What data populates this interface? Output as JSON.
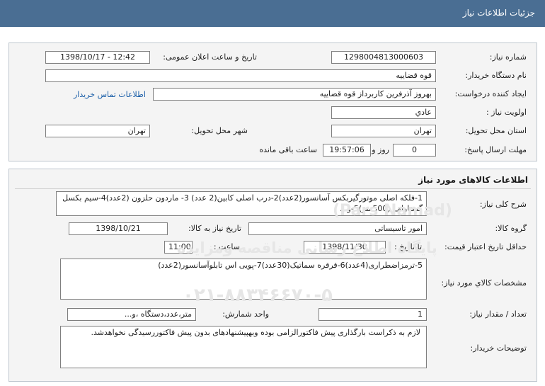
{
  "header": {
    "title": "جزئیات اطلاعات نیاز"
  },
  "info": {
    "need_number_label": "شماره نیاز:",
    "need_number": "1298004813000603",
    "announce_label": "تاریخ و ساعت اعلان عمومی:",
    "announce_value": "1398/10/17 - 12:42",
    "buyer_org_label": "نام دستگاه خریدار:",
    "buyer_org": "قوه قضاییه",
    "creator_label": "ایجاد کننده درخواست:",
    "creator": "بهروز آذرفرین کاربرداز قوه قضاییه",
    "contact_link": "اطلاعات تماس خریدار",
    "priority_label": "اولویت نیاز :",
    "priority": "عادي",
    "province_label": "استان محل تحویل:",
    "province": "تهران",
    "city_label": "شهر محل تحویل:",
    "city": "تهران",
    "deadline_label": "مهلت ارسال پاسخ:",
    "days": "0",
    "days_word": "روز و",
    "time_left": "19:57:06",
    "time_left_suffix": "ساعت باقی مانده"
  },
  "goods": {
    "section_title": "اطلاعات کالاهای مورد نیاز",
    "summary_label": "شرح کلی نیاز:",
    "summary": "1-فلکه اصلی موتورگیربکس آسانسور(2عدد)2-درب اصلی کابین(2 عدد) 3- ماردون حلزون (2عدد)4-سیم بکسل گستاولف (500متر)5-و...",
    "group_label": "گروه کالا:",
    "group": "امور تاسیساتی",
    "need_date_label": "تاریخ نیاز به کالا:",
    "need_date": "1398/10/21",
    "validity_label": "حداقل تاریخ اعتبار قیمت:",
    "until_label": "تا تاریخ :",
    "until_date": "1398/11/30",
    "hour_label": "ساعت :",
    "hour": "11:00",
    "spec_label": "مشخصات کالاي مورد نیاز:",
    "spec": "5-ترمزاضطراری(4عدد)6-قرقره سماتیک(30عدد)7-پویی اس تابلوآسانسور(2عدد)",
    "qty_label": "تعداد / مقدار نیاز:",
    "qty": "1",
    "unit_label": "واحد شمارش:",
    "unit": "متر،عدد،دستگاه ،و...",
    "buyer_notes_label": "توضیحات خریدار:",
    "buyer_notes": "لازم به ذکراست بارگذاری پیش فاکتورالزامی بوده وبهپیشنهادهای بدون پیش فاکتوررسیدگی نخواهدشد."
  },
  "watermark": {
    "brand": "(Pars Namad)",
    "org": "پایگاه اطلاع رسانی مناقصه ومزایده",
    "phone": "۰۲۱-۸۸۳۴۶۶۷۰-۵"
  }
}
